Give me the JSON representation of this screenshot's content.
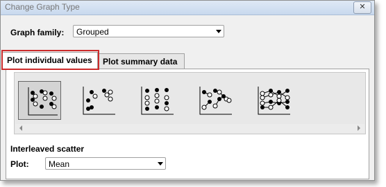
{
  "window": {
    "title": "Change Graph Type",
    "close_label": "✕"
  },
  "graph_family": {
    "label": "Graph family:",
    "value": "Grouped"
  },
  "tabs": [
    {
      "label": "Plot individual values",
      "active": true
    },
    {
      "label": "Plot summary data",
      "active": false
    }
  ],
  "gallery": {
    "selected_index": 0,
    "items": [
      {
        "icon": "interleaved-scatter-icon"
      },
      {
        "icon": "separated-scatter-icon"
      },
      {
        "icon": "stacked-scatter-icon"
      },
      {
        "icon": "connected-points-icon"
      },
      {
        "icon": "before-after-lines-icon"
      }
    ]
  },
  "selection_name": "Interleaved scatter",
  "plot": {
    "label": "Plot:",
    "value": "Mean"
  },
  "colors": {
    "highlight": "#cc2b2b",
    "gallery_bg": "#e8e8e8"
  }
}
